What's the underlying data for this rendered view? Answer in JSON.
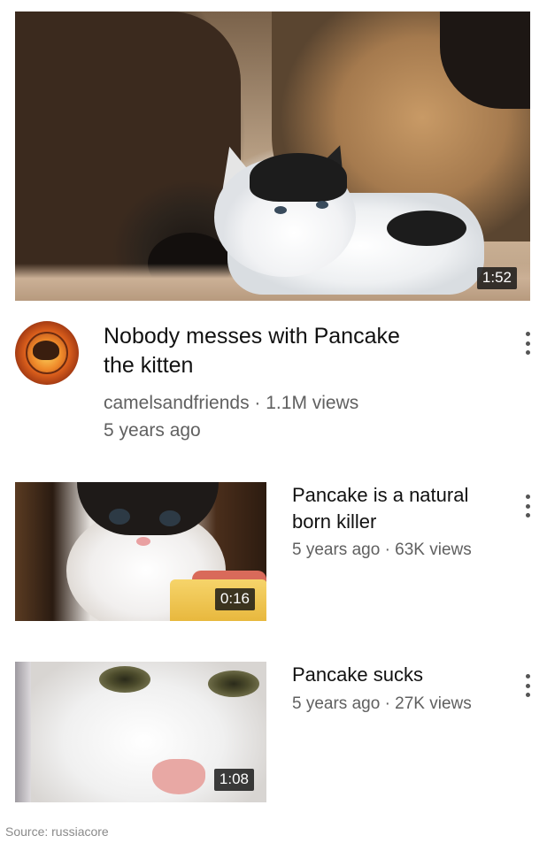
{
  "featured": {
    "duration": "1:52",
    "title_line1": "Nobody messes with Pancake",
    "title_line2": "the kitten",
    "channel_views": "camelsandfriends · 1.1M views",
    "age": "5 years ago"
  },
  "videos": [
    {
      "title_line1": "Pancake is a natural",
      "title_line2": "born killer",
      "meta": "5 years ago · 63K views",
      "duration": "0:16"
    },
    {
      "title_line1": "Pancake sucks",
      "meta": "5 years ago · 27K views",
      "duration": "1:08"
    }
  ],
  "source": "Source: russiacore",
  "icons": {
    "menu": "more-vert-icon"
  }
}
